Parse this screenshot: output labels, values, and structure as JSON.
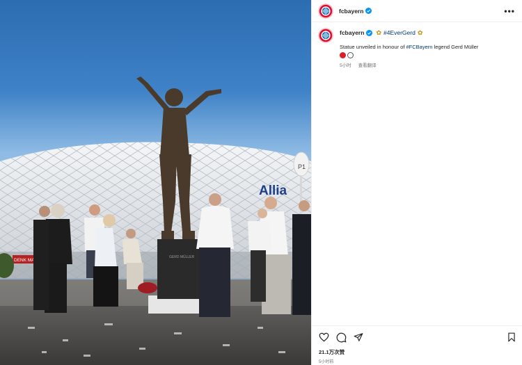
{
  "post": {
    "username": "fcbayern",
    "hashtag": "#4EverGerd",
    "caption_prefix": "Statue unveiled in honour of ",
    "caption_mention": "#FCBayern",
    "caption_suffix": " legend Gerd Müller",
    "time_ago": "5小时",
    "translate_label": "查看翻译",
    "views": "21.1万次赞",
    "posted_ago": "5小时前",
    "more_label": "•••"
  },
  "media": {
    "plaque_text": "GERD MÜLLER",
    "stadium_sign": "Allia",
    "gate_sign": "P1",
    "shop_sign": "DENK MAL"
  },
  "icons": {
    "avatar": "fc-bayern-logo",
    "verified": "verified-badge-icon",
    "heart": "heart-icon",
    "comment": "comment-icon",
    "share": "share-icon",
    "save": "bookmark-icon"
  },
  "colors": {
    "brand_red": "#dc0d2e",
    "brand_blue": "#0066b2",
    "verified_blue": "#0095f6",
    "link": "#00376b"
  }
}
